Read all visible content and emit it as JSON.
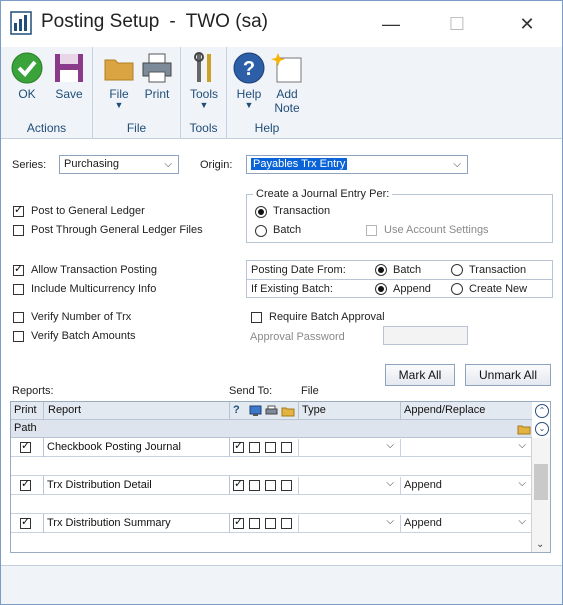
{
  "window": {
    "title": "Posting Setup",
    "title_sep": "-",
    "title_company": "TWO (sa)",
    "minimize_glyph": "—",
    "maximize_glyph": "☐",
    "close_glyph": "✕"
  },
  "ribbon": {
    "groups": {
      "actions": "Actions",
      "file": "File",
      "tools": "Tools",
      "help": "Help"
    },
    "buttons": {
      "ok": "OK",
      "save": "Save",
      "file": "File",
      "print": "Print",
      "tools": "Tools",
      "help": "Help",
      "add_note_line1": "Add",
      "add_note_line2": "Note"
    },
    "dropdown_glyph": "▼"
  },
  "form": {
    "series_label": "Series:",
    "series_value": "Purchasing",
    "origin_label": "Origin:",
    "origin_value": "Payables Trx Entry",
    "caret": "⌵",
    "journal_group_label": "Create a Journal Entry Per:",
    "journal_transaction": "Transaction",
    "journal_batch": "Batch",
    "use_account_settings": "Use Account Settings",
    "post_to_gl": "Post to General Ledger",
    "post_through_gl": "Post Through General Ledger Files",
    "allow_trx_posting": "Allow Transaction Posting",
    "include_multicurrency": "Include Multicurrency Info",
    "verify_number_trx": "Verify Number of Trx",
    "verify_batch_amounts": "Verify Batch Amounts",
    "posting_date_from_label": "Posting Date From:",
    "posting_date_batch": "Batch",
    "posting_date_transaction": "Transaction",
    "if_existing_batch_label": "If Existing Batch:",
    "existing_append": "Append",
    "existing_create_new": "Create New",
    "require_batch_approval": "Require Batch Approval",
    "approval_password_label": "Approval Password",
    "mark_all": "Mark All",
    "unmark_all": "Unmark All",
    "reports_label": "Reports:",
    "send_to_label": "Send To:",
    "file_label": "File"
  },
  "grid": {
    "headers": {
      "print": "Print",
      "report": "Report",
      "question": "?",
      "type": "Type",
      "append_replace": "Append/Replace",
      "path": "Path"
    },
    "rows": [
      {
        "report": "Checkbook Posting Journal",
        "append": ""
      },
      {
        "report": "Trx Distribution Detail",
        "append": "Append"
      },
      {
        "report": "Trx Distribution Summary",
        "append": "Append"
      }
    ]
  },
  "colors": {
    "ribbon_text": "#1f4e79",
    "selection": "#0a64d8"
  }
}
